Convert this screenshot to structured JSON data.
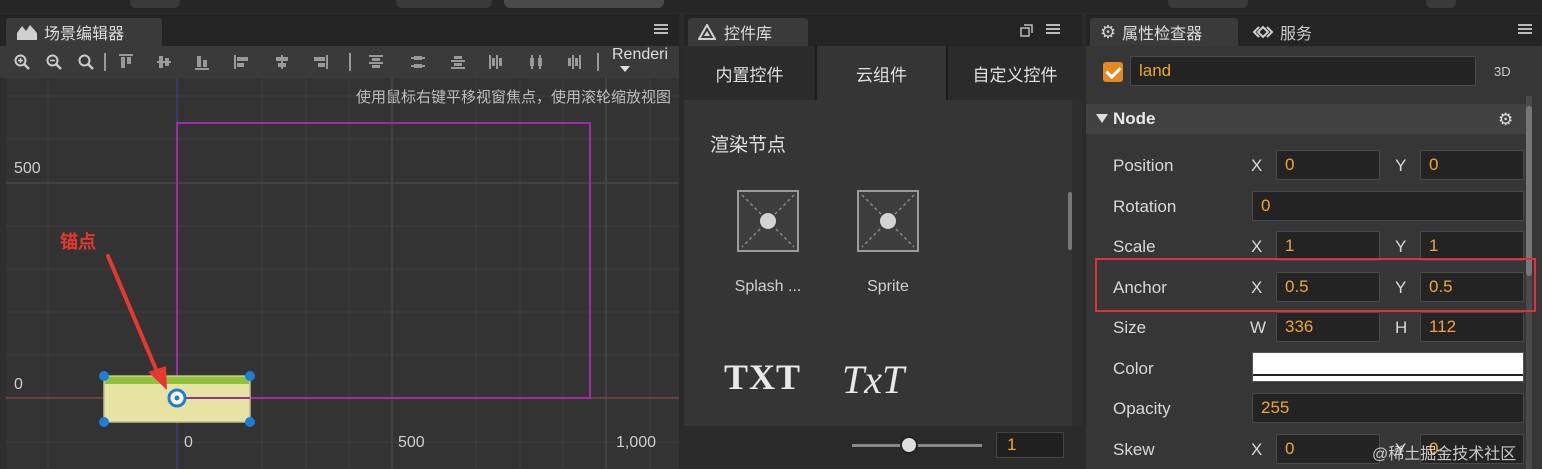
{
  "scene_panel": {
    "tab_title": "场景编辑器",
    "render_button": "Renderi",
    "hint": "使用鼠标右键平移视窗焦点，使用滚轮缩放视图",
    "axis_labels": {
      "y_500": "500",
      "y_0": "0",
      "x_0": "0",
      "x_500": "500",
      "x_1000": "1,000"
    },
    "annotation": "锚点",
    "colors": {
      "annotation": "#e5382e",
      "design_frame": "#a22aa6",
      "node_fill": "#e6e3a3",
      "handle": "#1c7ed6"
    }
  },
  "widget_library": {
    "tab_title": "控件库",
    "tabs": [
      {
        "label": "内置控件"
      },
      {
        "label": "云组件"
      },
      {
        "label": "自定义控件"
      }
    ],
    "section_title": "渲染节点",
    "widgets": [
      {
        "name": "Splash ...",
        "icon": "image-placeholder-icon"
      },
      {
        "name": "Sprite",
        "icon": "image-placeholder-icon"
      },
      {
        "name": "",
        "icon": "label-icon",
        "glyph": "TXT"
      },
      {
        "name": "",
        "icon": "richtext-icon",
        "glyph": "TxT"
      }
    ],
    "zoom_value": "1"
  },
  "inspector": {
    "tabs": [
      {
        "label": "属性检查器"
      },
      {
        "label": "服务"
      }
    ],
    "node_name": "land",
    "enabled": true,
    "mode_3d": "3D",
    "section": "Node",
    "properties": {
      "position": {
        "label": "Position",
        "x_axis": "X",
        "y_axis": "Y",
        "x": "0",
        "y": "0"
      },
      "rotation": {
        "label": "Rotation",
        "value": "0"
      },
      "scale": {
        "label": "Scale",
        "x_axis": "X",
        "y_axis": "Y",
        "x": "1",
        "y": "1"
      },
      "anchor": {
        "label": "Anchor",
        "x_axis": "X",
        "y_axis": "Y",
        "x": "0.5",
        "y": "0.5"
      },
      "size": {
        "label": "Size",
        "w_axis": "W",
        "h_axis": "H",
        "w": "336",
        "h": "112"
      },
      "color": {
        "label": "Color",
        "value": "#ffffff"
      },
      "opacity": {
        "label": "Opacity",
        "value": "255"
      },
      "skew": {
        "label": "Skew",
        "x_axis": "X",
        "y_axis": "Y",
        "x": "0",
        "y": "0"
      }
    },
    "highlight_color": "#e0303a",
    "accent": "#f0a43a"
  },
  "watermark": "@稀土掘金技术社区"
}
